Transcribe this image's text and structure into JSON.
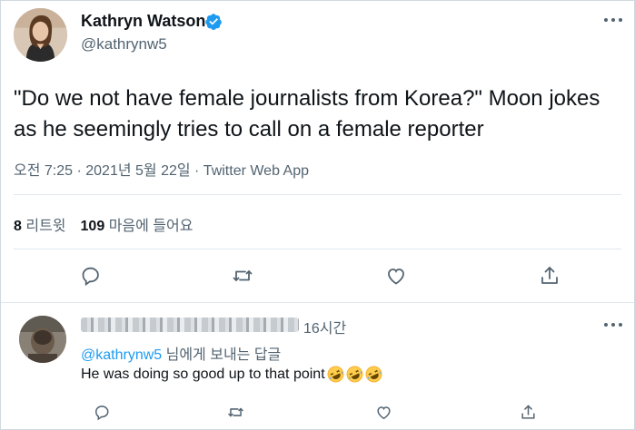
{
  "tweet": {
    "author": {
      "name": "Kathryn Watson",
      "handle": "@kathrynw5"
    },
    "text": "\"Do we not have female journalists from Korea?\" Moon jokes as he seemingly tries to call on a female reporter",
    "meta": "오전 7:25 · 2021년 5월 22일 · Twitter Web App",
    "stats": {
      "retweets_count": "8",
      "retweets_label": "리트윗",
      "likes_count": "109",
      "likes_label": "마음에 들어요"
    }
  },
  "reply": {
    "time": "16시간",
    "replying_mention": "@kathrynw5",
    "replying_suffix": " 님에게 보내는 답글",
    "text": "He was doing so good up to that point",
    "emoji": [
      "rolling-on-the-floor-laughing",
      "rolling-on-the-floor-laughing",
      "rolling-on-the-floor-laughing"
    ]
  },
  "colors": {
    "accent": "#1d9bf0",
    "secondary_text": "#536471",
    "divider": "#e1e8ed"
  }
}
